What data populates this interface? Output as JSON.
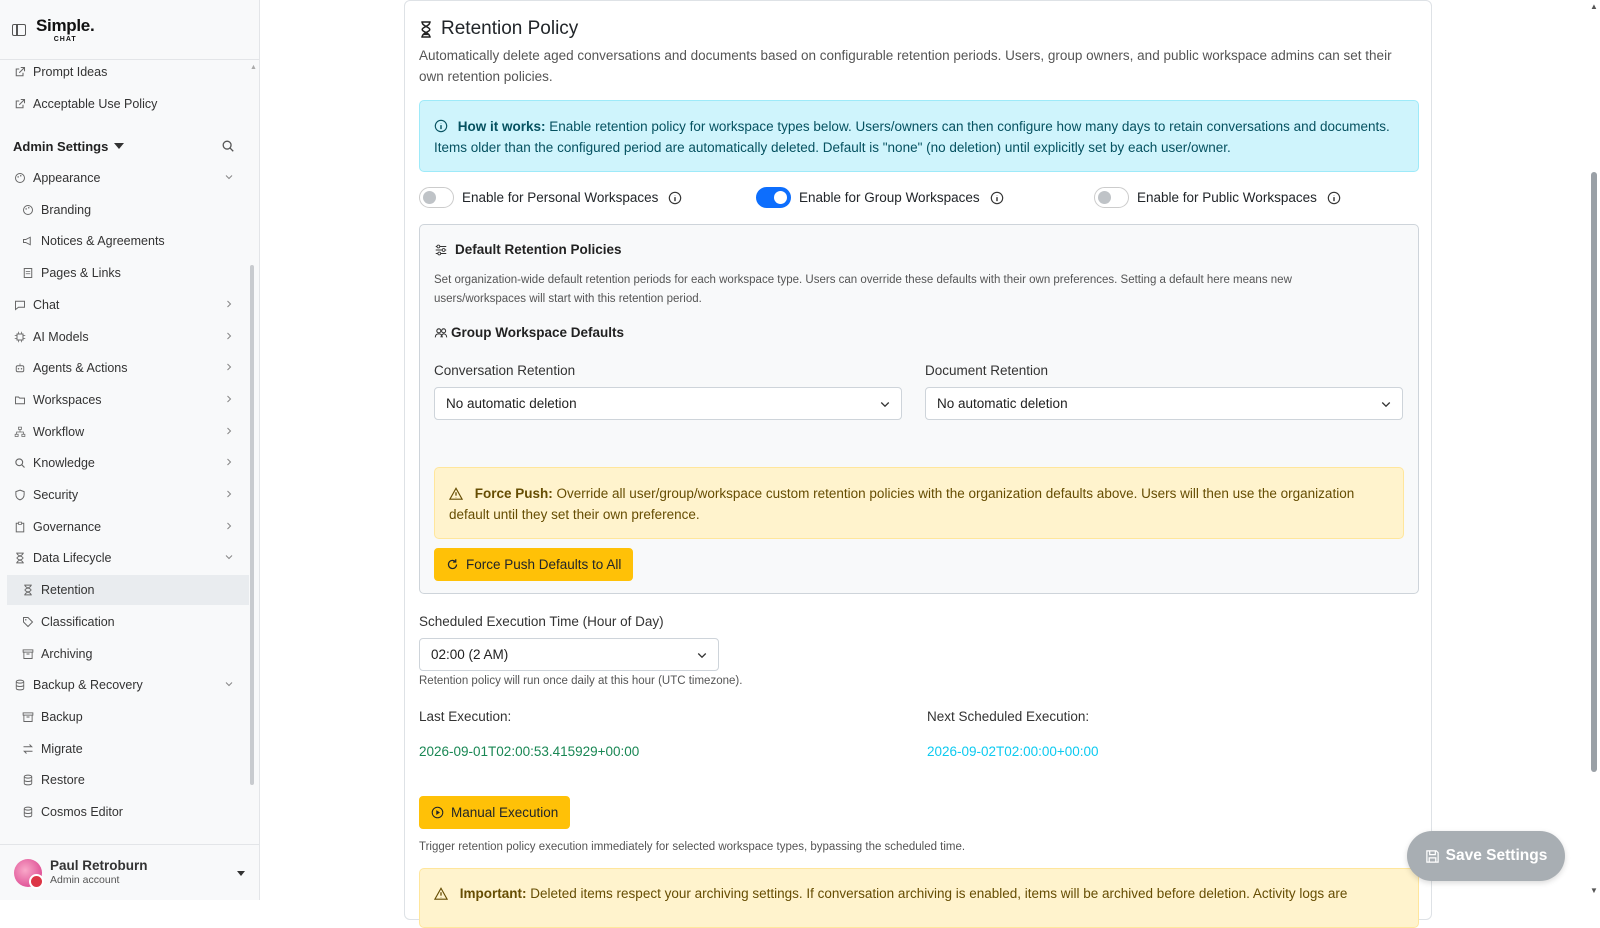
{
  "app": {
    "logo_text": "Simple.",
    "logo_sub": "CHAT"
  },
  "sidebar": {
    "links": [
      {
        "label": "Prompt Ideas",
        "icon": "external-link-icon"
      },
      {
        "label": "Acceptable Use Policy",
        "icon": "external-link-icon"
      }
    ],
    "admin_heading": "Admin Settings",
    "items": [
      {
        "label": "Appearance",
        "icon": "palette-icon",
        "level": 0,
        "expanded": true
      },
      {
        "label": "Branding",
        "icon": "palette-icon",
        "level": 1
      },
      {
        "label": "Notices & Agreements",
        "icon": "megaphone-icon",
        "level": 1
      },
      {
        "label": "Pages & Links",
        "icon": "pages-icon",
        "level": 1
      },
      {
        "label": "Chat",
        "icon": "chat-icon",
        "level": 0
      },
      {
        "label": "AI Models",
        "icon": "cpu-icon",
        "level": 0
      },
      {
        "label": "Agents & Actions",
        "icon": "robot-icon",
        "level": 0
      },
      {
        "label": "Workspaces",
        "icon": "folder-icon",
        "level": 0
      },
      {
        "label": "Workflow",
        "icon": "diagram-icon",
        "level": 0
      },
      {
        "label": "Knowledge",
        "icon": "search-icon",
        "level": 0
      },
      {
        "label": "Security",
        "icon": "shield-icon",
        "level": 0
      },
      {
        "label": "Governance",
        "icon": "clipboard-icon",
        "level": 0
      },
      {
        "label": "Data Lifecycle",
        "icon": "hourglass-icon",
        "level": 0,
        "expanded": true
      },
      {
        "label": "Retention",
        "icon": "hourglass-icon",
        "level": 1,
        "active": true
      },
      {
        "label": "Classification",
        "icon": "tag-icon",
        "level": 1
      },
      {
        "label": "Archiving",
        "icon": "archive-icon",
        "level": 1
      },
      {
        "label": "Backup & Recovery",
        "icon": "database-icon",
        "level": 0,
        "expanded": true
      },
      {
        "label": "Backup",
        "icon": "archive-icon",
        "level": 1
      },
      {
        "label": "Migrate",
        "icon": "arrows-icon",
        "level": 1
      },
      {
        "label": "Restore",
        "icon": "database-icon",
        "level": 1
      },
      {
        "label": "Cosmos Editor",
        "icon": "database-icon",
        "level": 1
      }
    ],
    "user": {
      "name": "Paul Retroburn",
      "role": "Admin account"
    }
  },
  "retention": {
    "title": "Retention Policy",
    "description": "Automatically delete aged conversations and documents based on configurable retention periods. Users, group owners, and public workspace admins can set their own retention policies.",
    "info_bold": "How it works:",
    "info_text": " Enable retention policy for workspace types below. Users/owners can then configure how many days to retain conversations and documents. Items older than the configured period are automatically deleted. Default is \"none\" (no deletion) until explicitly set by each user/owner.",
    "toggles": [
      {
        "label": "Enable for Personal Workspaces",
        "on": false
      },
      {
        "label": "Enable for Group Workspaces",
        "on": true
      },
      {
        "label": "Enable for Public Workspaces",
        "on": false
      }
    ],
    "defaults_title": "Default Retention Policies",
    "defaults_desc": "Set organization-wide default retention periods for each workspace type. Users can override these defaults with their own preferences. Setting a default here means new users/workspaces will start with this retention period.",
    "group_defaults_title": "Group Workspace Defaults",
    "conversation_label": "Conversation Retention",
    "conversation_value": "No automatic deletion",
    "document_label": "Document Retention",
    "document_value": "No automatic deletion",
    "force_bold": "Force Push:",
    "force_text": " Override all user/group/workspace custom retention policies with the organization defaults above. Users will then use the organization default until they set their own preference.",
    "force_button": "Force Push Defaults to All",
    "schedule_label": "Scheduled Execution Time (Hour of Day)",
    "schedule_value": "02:00 (2 AM)",
    "schedule_help": "Retention policy will run once daily at this hour (UTC timezone).",
    "last_label": "Last Execution:",
    "last_value": "2026-09-01T02:00:53.415929+00:00",
    "next_label": "Next Scheduled Execution:",
    "next_value": "2026-09-02T02:00:00+00:00",
    "manual_button": "Manual Execution",
    "manual_help": "Trigger retention policy execution immediately for selected workspace types, bypassing the scheduled time.",
    "important_bold": "Important:",
    "important_text": " Deleted items respect your archiving settings. If conversation archiving is enabled, items will be archived before deletion. Activity logs are"
  },
  "save_button": "Save Settings",
  "colors": {
    "primary": "#0d6efd",
    "warning": "#ffc107",
    "success": "#198754",
    "info": "#0dcaf0"
  }
}
